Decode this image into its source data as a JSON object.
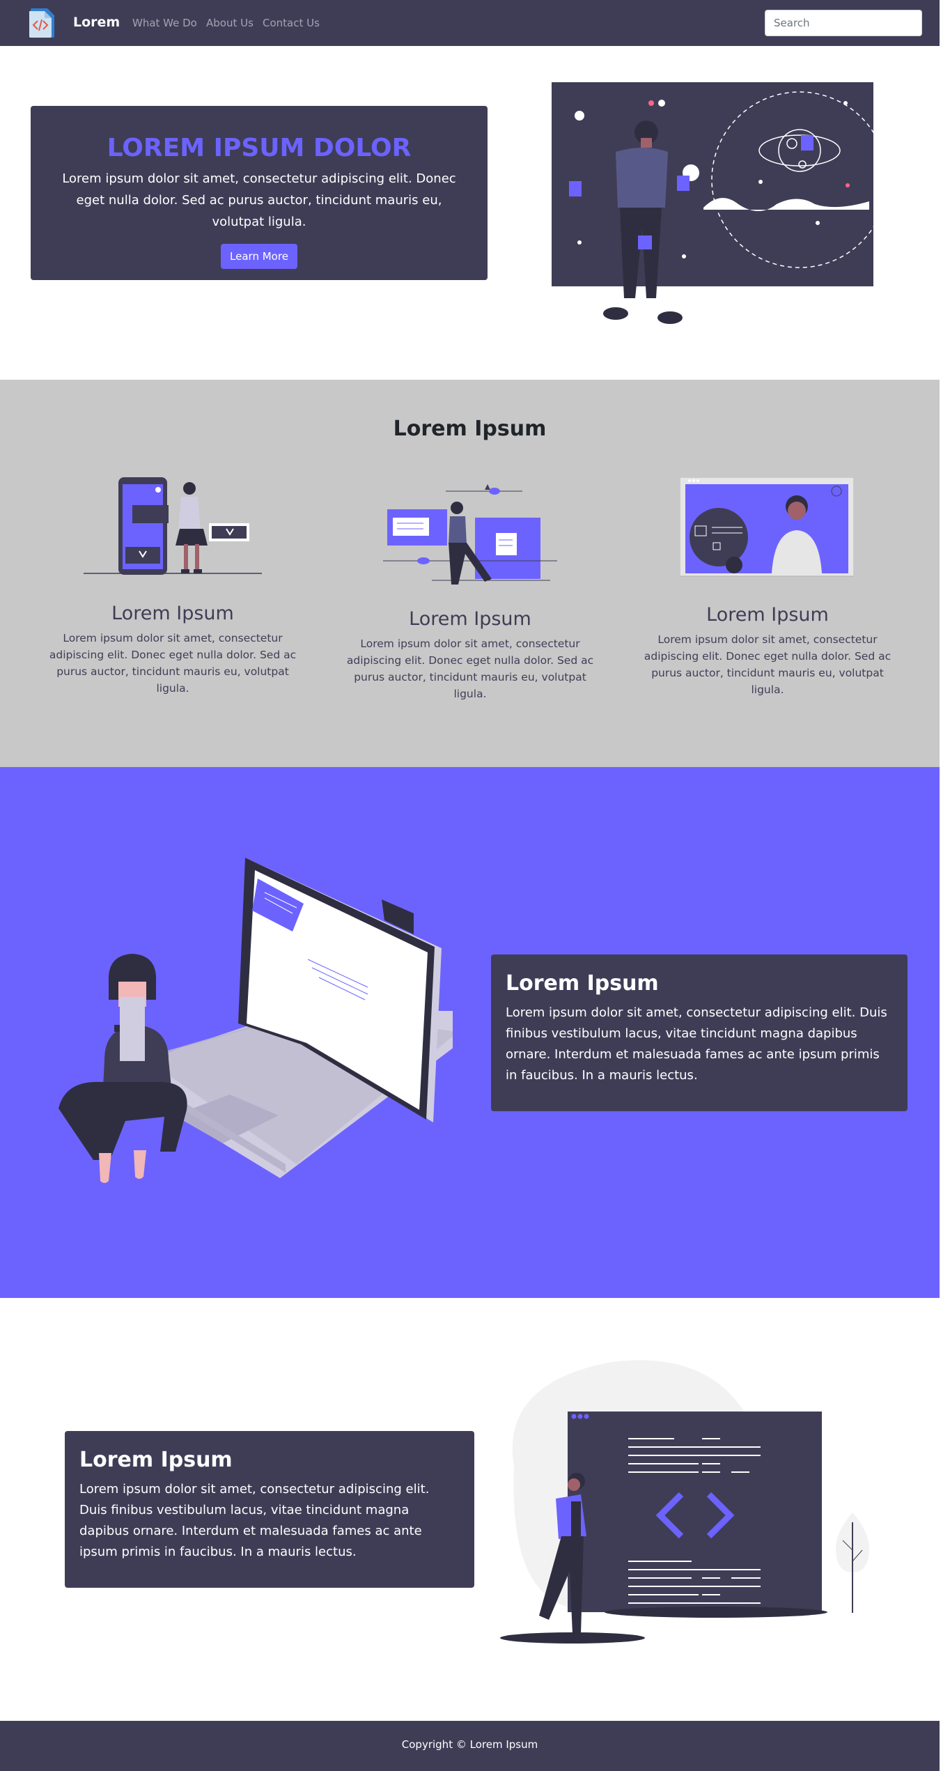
{
  "nav": {
    "brand": "Lorem",
    "links": [
      "What We Do",
      "About Us",
      "Contact Us"
    ],
    "search_placeholder": "Search"
  },
  "hero": {
    "title": "LOREM IPSUM DOLOR",
    "text": "Lorem ipsum dolor sit amet, consectetur adipiscing elit. Donec eget nulla dolor. Sed ac purus auctor, tincidunt mauris eu, volutpat ligula.",
    "button": "Learn More"
  },
  "features": {
    "title": "Lorem Ipsum",
    "items": [
      {
        "title": "Lorem Ipsum",
        "text": "Lorem ipsum dolor sit amet, consectetur adipiscing elit. Donec eget nulla dolor. Sed ac purus auctor, tincidunt mauris eu, volutpat ligula."
      },
      {
        "title": "Lorem Ipsum",
        "text": "Lorem ipsum dolor sit amet, consectetur adipiscing elit. Donec eget nulla dolor. Sed ac purus auctor, tincidunt mauris eu, volutpat ligula."
      },
      {
        "title": "Lorem Ipsum",
        "text": "Lorem ipsum dolor sit amet, consectetur adipiscing elit. Donec eget nulla dolor. Sed ac purus auctor, tincidunt mauris eu, volutpat ligula."
      }
    ]
  },
  "section_one": {
    "title": "Lorem Ipsum",
    "text": "Lorem ipsum dolor sit amet, consectetur adipiscing elit. Duis finibus vestibulum lacus, vitae tincidunt magna dapibus ornare. Interdum et malesuada fames ac ante ipsum primis in faucibus. In a mauris lectus."
  },
  "section_two": {
    "title": "Lorem Ipsum",
    "text": "Lorem ipsum dolor sit amet, consectetur adipiscing elit. Duis finibus vestibulum lacus, vitae tincidunt magna dapibus ornare. Interdum et malesuada fames ac ante ipsum primis in faucibus. In a mauris lectus."
  },
  "footer": {
    "copyright": "Copyright © Lorem Ipsum"
  },
  "colors": {
    "dark": "#3f3d56",
    "accent": "#6c63ff",
    "features_bg": "#c8c8c8",
    "white": "#ffffff"
  },
  "icons": [
    "code-file-logo-icon"
  ]
}
